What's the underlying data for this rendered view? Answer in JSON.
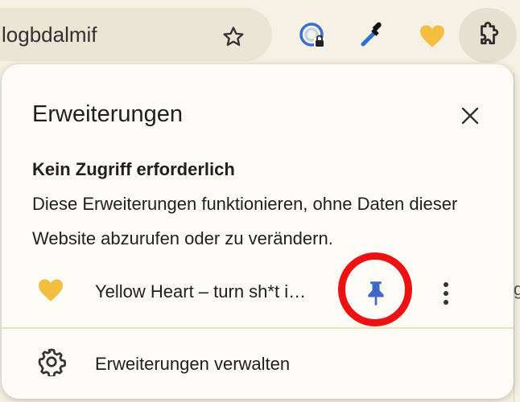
{
  "toolbar": {
    "omnibox_text": "logbdalmif",
    "icons": [
      "star-icon",
      "site-permissions-icon",
      "eyedropper-icon",
      "yellow-heart-icon",
      "extensions-puzzle-icon"
    ]
  },
  "popup": {
    "title": "Erweiterungen",
    "section_heading": "Kein Zugriff erforderlich",
    "section_description": "Diese Erweiterungen funktionieren, ohne Daten dieser Website abzurufen oder zu verändern.",
    "extension": {
      "name": "Yellow Heart – turn sh*t i…",
      "icon": "yellow-heart-icon",
      "pinned": true
    },
    "manage_label": "Erweiterungen verwalten"
  },
  "colors": {
    "heart": "#f4bf40",
    "pin": "#3f68c8",
    "highlight_ring": "#ee1111",
    "divider": "#ece3b6"
  }
}
